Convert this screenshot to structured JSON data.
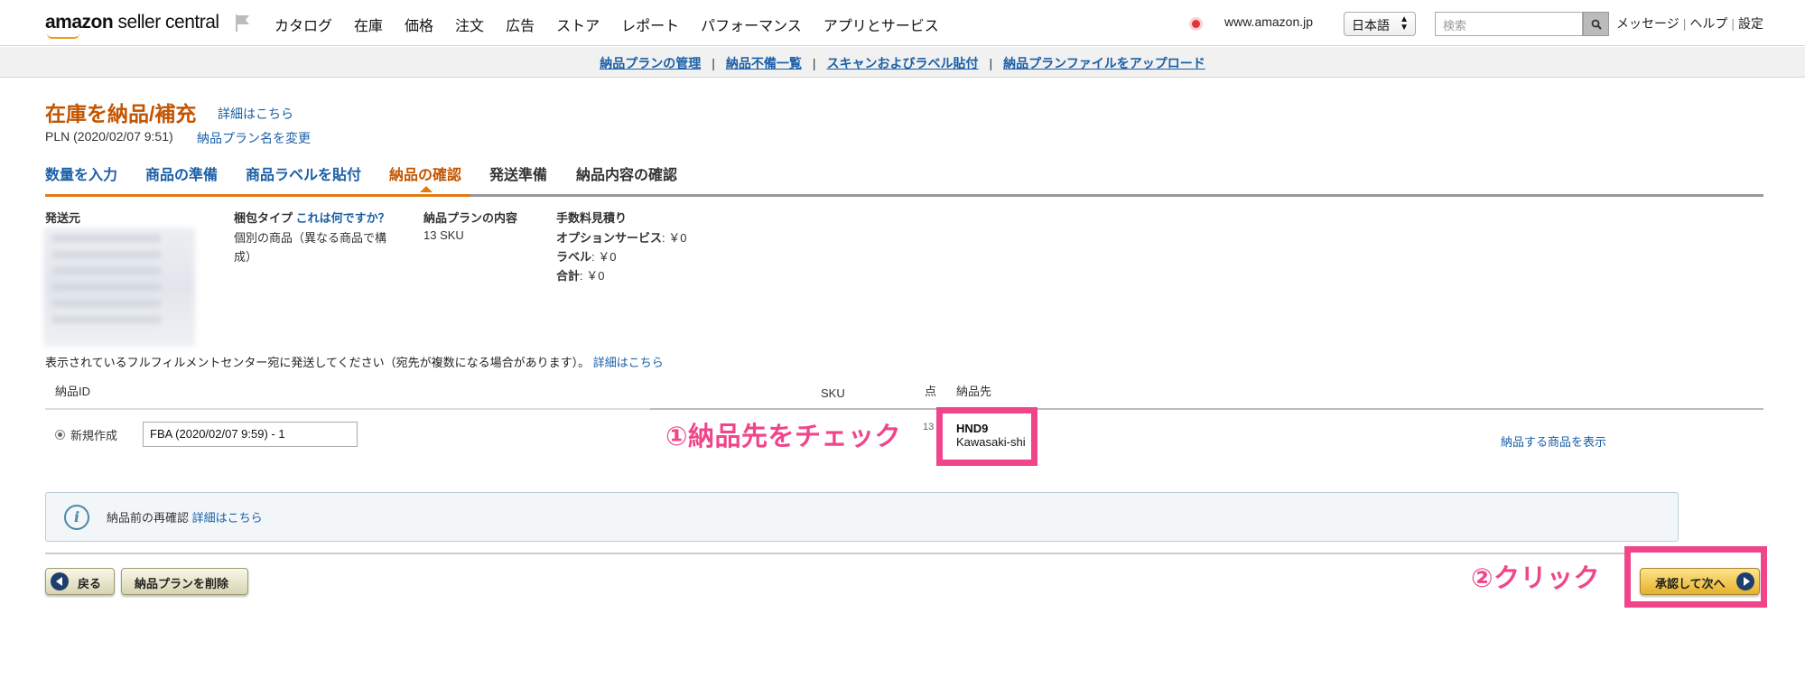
{
  "topnav": {
    "logo_main": "amazon",
    "logo_sub": "seller central",
    "items": [
      "カタログ",
      "在庫",
      "価格",
      "注文",
      "広告",
      "ストア",
      "レポート",
      "パフォーマンス",
      "アプリとサービス"
    ],
    "domain": "www.amazon.jp",
    "language": "日本語",
    "search_placeholder": "検索",
    "messages": "メッセージ",
    "help": "ヘルプ",
    "settings": "設定"
  },
  "subnav": {
    "items": [
      "納品プランの管理",
      "納品不備一覧",
      "スキャンおよびラベル貼付",
      "納品プランファイルをアップロード"
    ],
    "separator": "|"
  },
  "page": {
    "title": "在庫を納品/補充",
    "title_link": "詳細はこちら",
    "plan_name": "PLN (2020/02/07 9:51)",
    "rename_link": "納品プラン名を変更"
  },
  "tabs": [
    {
      "label": "数量を入力",
      "state": "done"
    },
    {
      "label": "商品の準備",
      "state": "done"
    },
    {
      "label": "商品ラベルを貼付",
      "state": "done"
    },
    {
      "label": "納品の確認",
      "state": "active"
    },
    {
      "label": "発送準備",
      "state": "pending"
    },
    {
      "label": "納品内容の確認",
      "state": "pending"
    }
  ],
  "summary": {
    "ship_from_label": "発送元",
    "packing_label": "梱包タイプ",
    "packing_help": "これは何ですか？",
    "packing_value_1": "個別の商品（異なる商品で構",
    "packing_value_2": "成）",
    "contents_label": "納品プランの内容",
    "contents_value": "13 SKU",
    "fees_label": "手数料見積り",
    "option_label": "オプションサービス",
    "option_value": ": ￥0",
    "label_label": "ラベル",
    "label_value": ": ￥0",
    "total_label": "合計",
    "total_value": ": ￥0"
  },
  "shipments": {
    "instruction": "表示されているフルフィルメントセンター宛に発送してください（宛先が複数になる場合があります）。",
    "instruction_link": "詳細はこちら",
    "columns": {
      "id": "納品ID",
      "sku": "SKU",
      "units": "点",
      "destination": "納品先"
    },
    "rows": [
      {
        "option_label": "新規作成",
        "name_value": "FBA (2020/02/07 9:59) - 1",
        "sku": "13",
        "destination_code": "HND9",
        "destination_city": "Kawasaki-shi",
        "view_link": "納品する商品を表示"
      }
    ]
  },
  "annotations": {
    "step1": "①納品先をチェック",
    "step2": "②クリック",
    "highlight_color": "#f0458a"
  },
  "info_box": {
    "text": "納品前の再確認",
    "link": "詳細はこちら"
  },
  "actions": {
    "back": "戻る",
    "delete": "納品プランを削除",
    "approve": "承認して次へ"
  },
  "colors": {
    "accent_orange": "#c45500",
    "link_blue": "#1a5fa6",
    "annotation_pink": "#f0458a"
  }
}
